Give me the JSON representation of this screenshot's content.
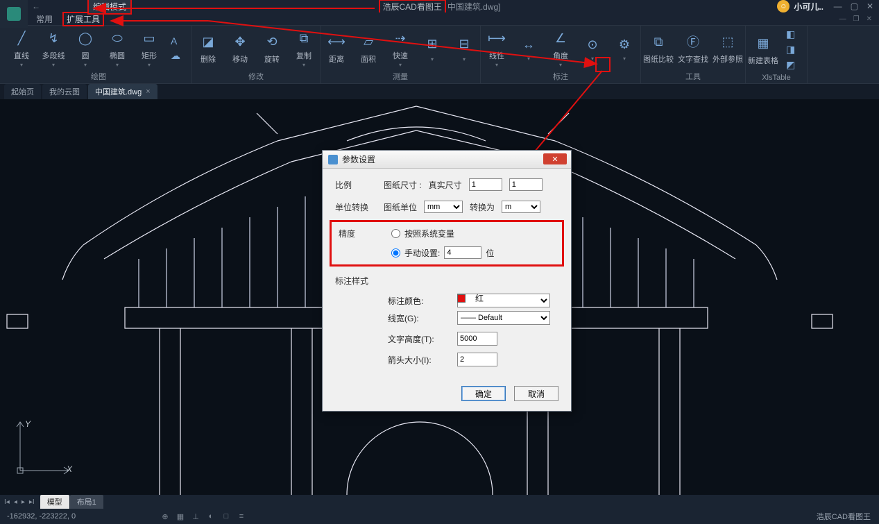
{
  "app": {
    "title_prefix": "浩辰CAD看图王",
    "title_suffix": "中国建筑.dwg]",
    "user_name": "小可儿..",
    "footer_brand": "浩辰CAD看图王"
  },
  "topbar": {
    "edit_mode": "编辑模式"
  },
  "menu": {
    "common": "常用",
    "extend": "扩展工具"
  },
  "ribbon": {
    "draw": {
      "line": "直线",
      "polyline": "多段线",
      "circle": "圆",
      "ellipse": "椭圆",
      "rect": "矩形",
      "text": "A",
      "group": "绘图"
    },
    "modify": {
      "erase": "删除",
      "move": "移动",
      "rotate": "旋转",
      "copy": "复制",
      "group": "修改"
    },
    "measure": {
      "distance": "距离",
      "area": "面积",
      "quick": "快速",
      "m1": "",
      "m2": "",
      "group": "测量"
    },
    "dim": {
      "linear": "线性",
      "d2": "",
      "angle": "角度",
      "d4": "",
      "d5": "",
      "group": "标注"
    },
    "tools": {
      "compare": "图纸比较",
      "findtext": "文字查找",
      "xref": "外部参照",
      "group": "工具"
    },
    "table": {
      "newtable": "新建表格",
      "group": "XlsTable"
    }
  },
  "tabs": {
    "start": "起始页",
    "cloud": "我的云图",
    "current": "中国建筑.dwg"
  },
  "model_tabs": {
    "model": "模型",
    "layout1": "布局1"
  },
  "status": {
    "coords": "-162932, -223222, 0"
  },
  "dialog": {
    "title": "参数设置",
    "ratio_lbl": "比例",
    "paper_size_lbl": "图纸尺寸 :",
    "real_size_lbl": "真实尺寸",
    "paper_val": "1",
    "real_val": "1",
    "unit_lbl": "单位转换",
    "paper_unit_lbl": "图纸单位",
    "paper_unit_val": "mm",
    "convert_lbl": "转换为",
    "convert_val": "m",
    "precision_lbl": "精度",
    "sys_var": "按照系统变量",
    "manual": "手动设置:",
    "manual_val": "4",
    "manual_unit": "位",
    "style_lbl": "标注样式",
    "color_lbl": "标注颜色:",
    "color_val": "红",
    "lw_lbl": "线宽(G):",
    "lw_val": "Default",
    "textheight_lbl": "文字高度(T):",
    "textheight_val": "5000",
    "arrow_lbl": "箭头大小(I):",
    "arrow_val": "2",
    "ok": "确定",
    "cancel": "取消"
  }
}
